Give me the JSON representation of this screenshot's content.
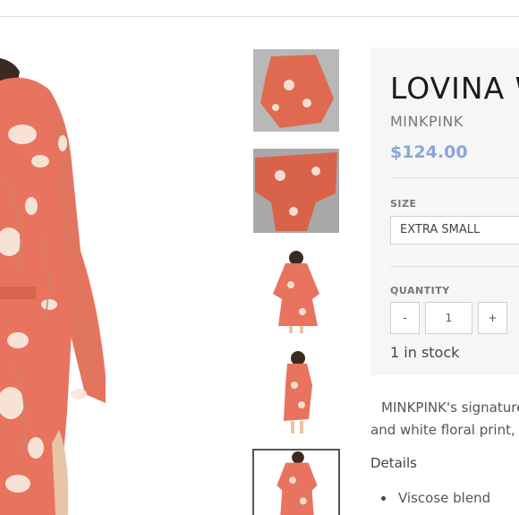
{
  "product": {
    "title": "LOVINA W",
    "brand": "MINKPINK",
    "price": "$124.00"
  },
  "size": {
    "label": "SIZE",
    "selected": "EXTRA SMALL"
  },
  "quantity": {
    "label": "QUANTITY",
    "decrement": "-",
    "value": "1",
    "increment": "+"
  },
  "stock": "1 in stock",
  "description": {
    "line1": "MINKPINK's signature",
    "line2": "and white floral print,"
  },
  "details": {
    "heading": "Details",
    "items": [
      "Viscose blend"
    ]
  },
  "colors": {
    "price": "#8aa6d8",
    "dress": "#e8735f",
    "panel": "#f6f6f6"
  }
}
